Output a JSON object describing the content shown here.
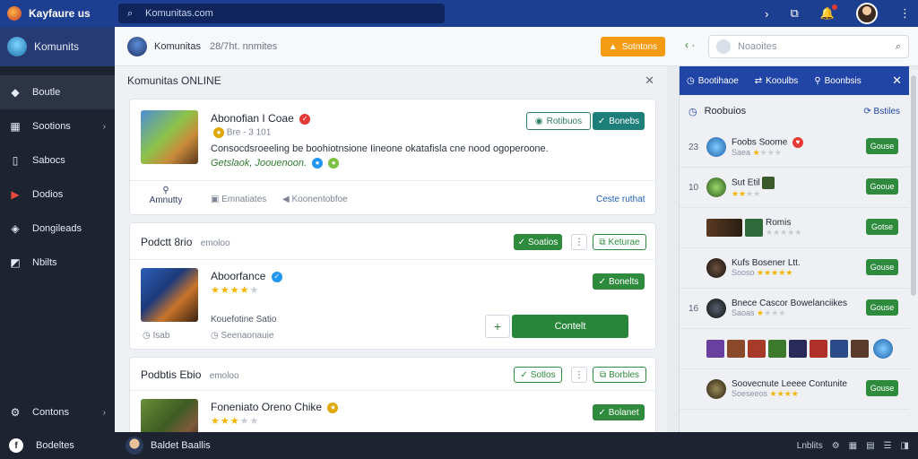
{
  "topbar": {
    "brand": "Kayfaure us",
    "search_placeholder": "Komunitas.com"
  },
  "sidebar": {
    "header": "Komunits",
    "items": [
      {
        "label": "Boutle",
        "icon": "puzzle-icon"
      },
      {
        "label": "Sootions",
        "icon": "grid-icon"
      },
      {
        "label": "Sabocs",
        "icon": "phone-icon"
      },
      {
        "label": "Dodios",
        "icon": "play-icon"
      },
      {
        "label": "Dongileads",
        "icon": "download-icon"
      },
      {
        "label": "Nbilts",
        "icon": "image-icon"
      }
    ],
    "bottom": "Contons"
  },
  "subbar": {
    "name": "Komunitas",
    "count": "28/7ht. nnmites",
    "action_button": "Sotntons",
    "search_placeholder": "Noaoites"
  },
  "main": {
    "title": "Komunitas ONLINE",
    "card1": {
      "title": "Abonofian I Coae",
      "meta": "Bre - 3 101",
      "follow_button": "Rotibuos",
      "join_button": "Bonebs",
      "description": "Consocdsroeeling be boohiotnsione Iineone okatafisla cne nood ogoperoone.",
      "tagline": "Getslaok, Joouenoon.",
      "footer_left": "Amnutty",
      "footer_mid": "Emnatiates",
      "footer_mid2": "Koonentobfoe",
      "footer_right": "Ceste ruthat"
    },
    "card2": {
      "header": "Podctt 8rio",
      "header_sub": "emoloo",
      "btn_a": "Soatios",
      "btn_b": "Keturae",
      "title": "Aboorfance",
      "btn_c": "Bonelts",
      "subtitle": "Kouefotine Satio",
      "meta_left": "Isab",
      "meta_right": "Seenaonauie",
      "action": "Contelt"
    },
    "card3": {
      "header": "Podbtis Ebio",
      "header_sub": "emoloo",
      "btn_a": "Sotlos",
      "btn_b": "Borbles",
      "title": "Foneniato Oreno Chike",
      "btn_c": "Bolanet"
    }
  },
  "right": {
    "tabs": [
      "Bootihaoe",
      "Kooulbs",
      "Boonbsis"
    ],
    "head": "Roobuios",
    "head_link": "Bstiles",
    "rows": [
      {
        "rank": "23",
        "name": "Foobs Soome",
        "sub": "Saea",
        "btn": "Gouse"
      },
      {
        "rank": "10",
        "name": "Sut Etil",
        "sub": "",
        "btn": "Gooue"
      },
      {
        "rank": "",
        "name": "Romis",
        "sub": "",
        "btn": "Gotse"
      },
      {
        "rank": "",
        "name": "Kufs Bosener Ltt.",
        "sub": "Sooso",
        "btn": "Gouse"
      },
      {
        "rank": "16",
        "name": "Bnece Cascor Bowelanciikes",
        "sub": "Saoas",
        "btn": "Gouse"
      },
      {
        "rank": "",
        "name": "",
        "sub": "",
        "btn": ""
      },
      {
        "rank": "",
        "name": "Soovecnute Leeee Contunite",
        "sub": "Soeseeos",
        "btn": "Gouse"
      }
    ]
  },
  "footer": {
    "brand": "Bodeltes",
    "user": "Baldet Baallis",
    "right": "Lnblits"
  },
  "colors": {
    "topbar": "#1d3f91",
    "sidebar": "#1d2331",
    "accent_green": "#2e8b3e",
    "accent_orange": "#f39c12"
  }
}
